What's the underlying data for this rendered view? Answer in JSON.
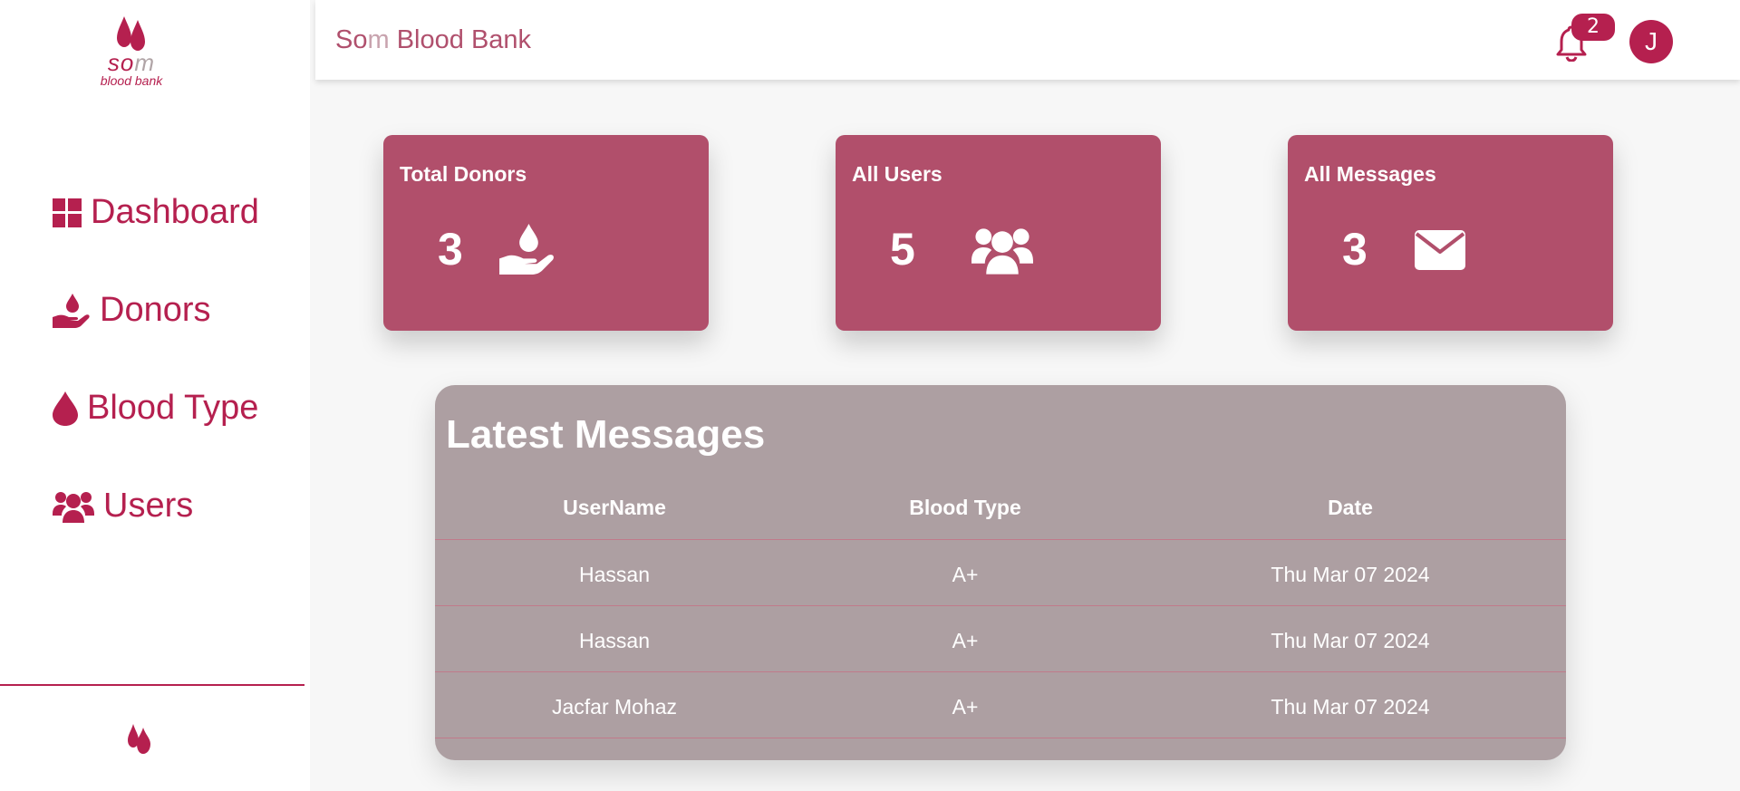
{
  "brand": {
    "logo_text_s": "so",
    "logo_text_m": "m",
    "logo_sub": "blood bank",
    "title_start": "So",
    "title_m": "m",
    "title_end": " Blood Bank"
  },
  "colors": {
    "accent": "#b5204f",
    "card": "#b14f6b",
    "panel": "#ad9fa2"
  },
  "sidebar": {
    "items": [
      {
        "label": "Dashboard",
        "icon": "grid-icon"
      },
      {
        "label": "Donors",
        "icon": "hand-drop-icon"
      },
      {
        "label": "Blood Type",
        "icon": "drop-icon"
      },
      {
        "label": "Users",
        "icon": "users-icon"
      }
    ]
  },
  "header": {
    "notification_count": "2",
    "avatar_initial": "J"
  },
  "cards": [
    {
      "title": "Total Donors",
      "value": "3",
      "icon": "hand-drop-icon"
    },
    {
      "title": "All Users",
      "value": "5",
      "icon": "users-icon"
    },
    {
      "title": "All Messages",
      "value": "3",
      "icon": "envelope-icon"
    }
  ],
  "messages": {
    "title": "Latest Messages",
    "columns": [
      "UserName",
      "Blood Type",
      "Date"
    ],
    "rows": [
      {
        "username": "Hassan",
        "blood_type": "A+",
        "date": "Thu Mar 07 2024"
      },
      {
        "username": "Hassan",
        "blood_type": "A+",
        "date": "Thu Mar 07 2024"
      },
      {
        "username": "Jacfar Mohaz",
        "blood_type": "A+",
        "date": "Thu Mar 07 2024"
      }
    ]
  }
}
